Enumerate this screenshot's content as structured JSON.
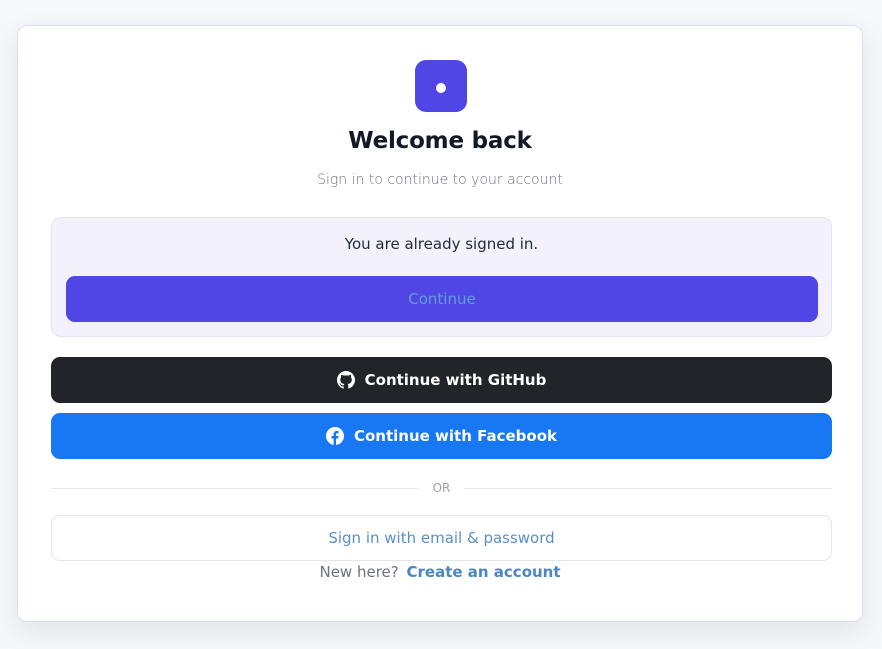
{
  "header": {
    "title": "Welcome back",
    "subtitle": "Sign in to continue to your account"
  },
  "session": {
    "message": "You are already signed in.",
    "continue_label": "Continue"
  },
  "providers": {
    "github_label": "Continue with GitHub",
    "facebook_label": "Continue with Facebook"
  },
  "divider": {
    "text": "OR"
  },
  "email": {
    "label": "Sign in with email & password"
  },
  "footer": {
    "prompt": "New here?",
    "link": "Create an account"
  },
  "icons": {
    "logo": "app-logo-icon",
    "github": "github-icon",
    "facebook": "facebook-icon"
  },
  "colors": {
    "brand": "#4f46e5",
    "github": "#212429",
    "facebook": "#1877f2",
    "link": "#4a86c4"
  }
}
